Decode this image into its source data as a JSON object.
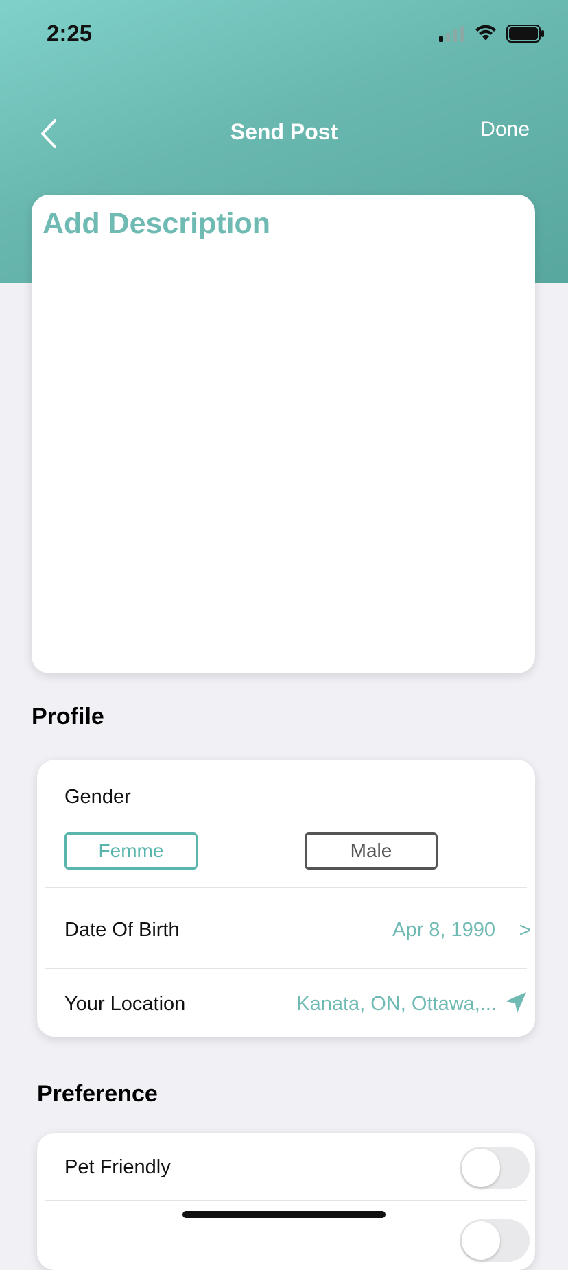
{
  "status": {
    "time": "2:25"
  },
  "nav": {
    "title": "Send Post",
    "done_label": "Done"
  },
  "description": {
    "placeholder": "Add Description"
  },
  "profile": {
    "section_title": "Profile",
    "gender_label": "Gender",
    "gender_options": [
      "Femme",
      "Male"
    ],
    "selected_gender": "Femme",
    "dob_label": "Date Of Birth",
    "dob_value": "Apr 8, 1990",
    "dob_chevron": ">",
    "location_label": "Your Location",
    "location_value": "Kanata, ON, Ottawa,..."
  },
  "preference": {
    "section_title": "Preference",
    "items": [
      {
        "label": "Pet Friendly",
        "enabled": false
      }
    ]
  },
  "colors": {
    "accent": "#5ab5ad",
    "header_gradient_start": "#7fd1c9",
    "header_gradient_end": "#58a79f",
    "background": "#f1f0f5"
  }
}
